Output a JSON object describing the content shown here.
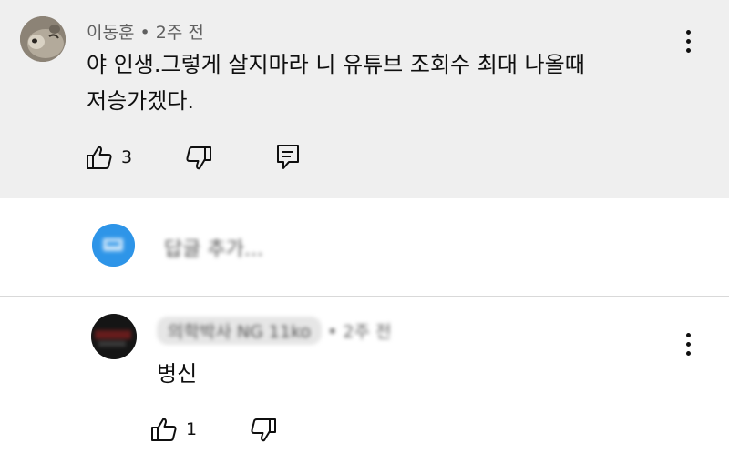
{
  "comments": [
    {
      "author": "이동훈",
      "separator": "•",
      "time": "2주 전",
      "text_line1": "야 인생.그렇게 살지마라 니 유튜브 조회수 최대 나올때",
      "text_line2": "저승가겠다.",
      "like_count": "3",
      "avatar_icon": "dog-avatar-icon"
    },
    {
      "author": "의학박사 NG 11ko",
      "separator": "•",
      "time": "2주 전",
      "text": "병신",
      "like_count": "1",
      "avatar_icon": "dark-avatar-icon"
    }
  ],
  "reply_box": {
    "placeholder": "답글 추가...",
    "avatar_icon": "user-avatar-icon",
    "avatar_color": "#1e88e5"
  },
  "colors": {
    "highlight_bg": "#efefef",
    "meta_text": "#606060",
    "primary_text": "#0f0f0f"
  }
}
